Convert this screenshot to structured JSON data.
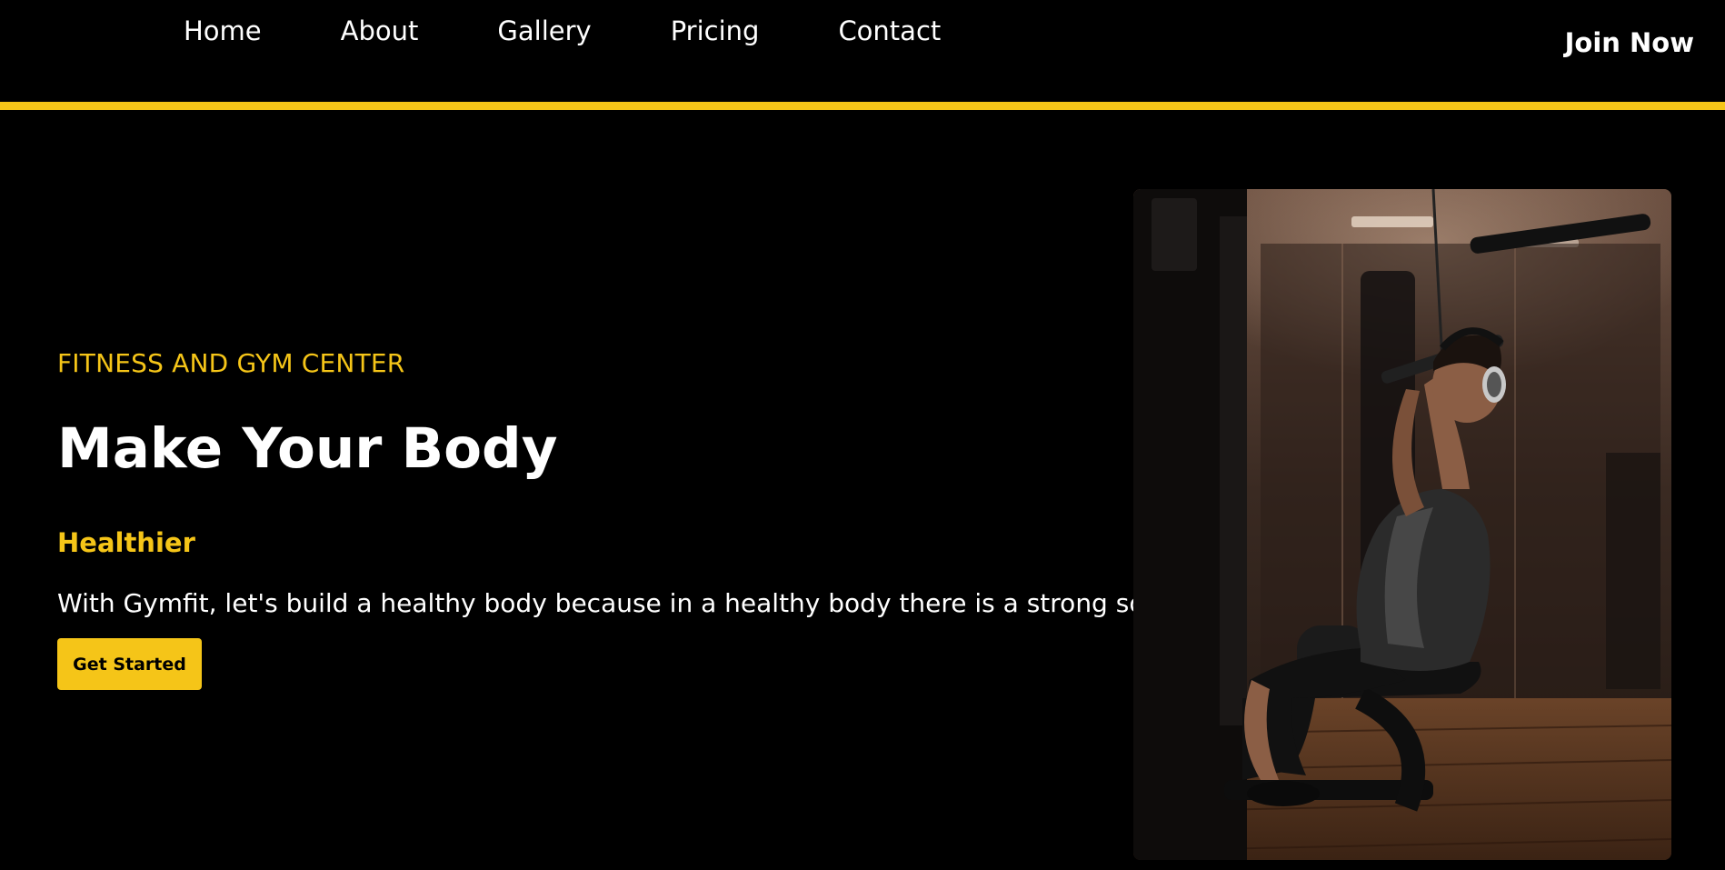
{
  "nav": {
    "links": [
      "Home",
      "About",
      "Gallery",
      "Pricing",
      "Contact"
    ],
    "join_label": "Join Now"
  },
  "hero": {
    "eyebrow": "FITNESS AND GYM CENTER",
    "headline": "Make Your Body",
    "subhead": "Healthier",
    "description": "With Gymfit, let's build a healthy body because in a healthy body there is a strong soul",
    "cta_label": "Get Started"
  },
  "colors": {
    "background": "#000000",
    "accent": "#F5C518",
    "text": "#FFFFFF"
  }
}
